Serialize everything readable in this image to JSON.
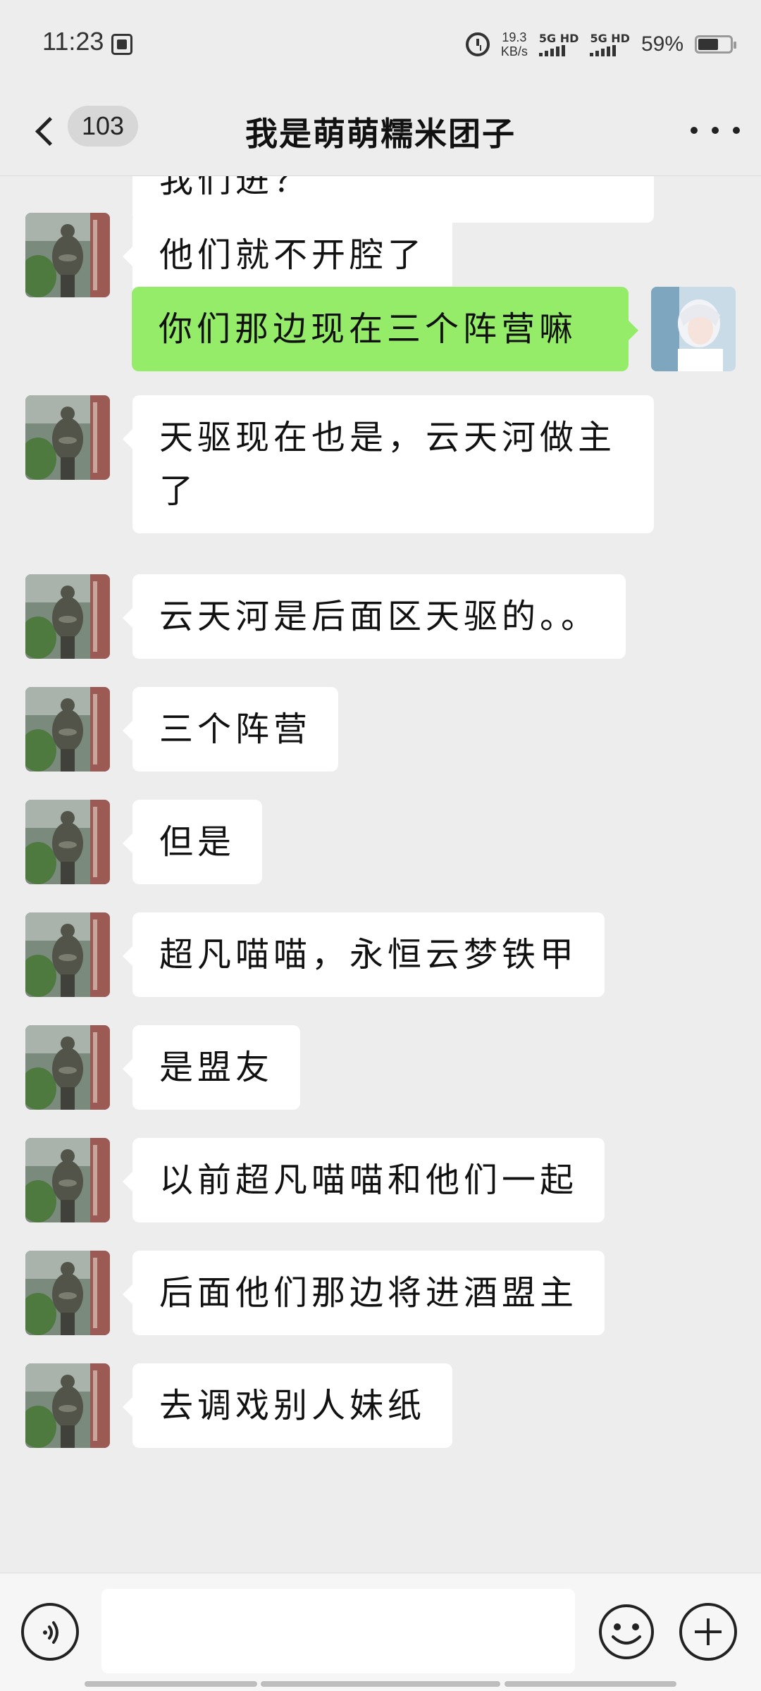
{
  "status_bar": {
    "time": "11:23",
    "net_speed_value": "19.3",
    "net_speed_unit": "KB/s",
    "sim1": "5G HD",
    "sim2": "5G HD",
    "battery": "59%",
    "battery_level": 0.59
  },
  "header": {
    "unread_count": "103",
    "title": "我是萌萌糯米团子"
  },
  "messages": [
    {
      "side": "in",
      "text": "自己和盟友闹掰。你们会让我们进？"
    },
    {
      "side": "in",
      "text": "他们就不开腔了"
    },
    {
      "side": "out",
      "text": "你们那边现在三个阵营嘛"
    },
    {
      "side": "in",
      "text": "天驱现在也是，云天河做主了"
    },
    {
      "side": "in",
      "text": "云天河是后面区天驱的。。"
    },
    {
      "side": "in",
      "text": "三个阵营"
    },
    {
      "side": "in",
      "text": "但是"
    },
    {
      "side": "in",
      "text": "超凡喵喵，永恒云梦铁甲"
    },
    {
      "side": "in",
      "text": "是盟友"
    },
    {
      "side": "in",
      "text": "以前超凡喵喵和他们一起"
    },
    {
      "side": "in",
      "text": "后面他们那边将进酒盟主"
    },
    {
      "side": "in",
      "text": "去调戏别人妹纸"
    }
  ],
  "colors": {
    "background": "#ededed",
    "incoming_bubble": "#ffffff",
    "outgoing_bubble": "#95ec69"
  },
  "icons": {
    "back": "chevron-left-icon",
    "more": "ellipsis-icon",
    "voice": "voice-icon",
    "emoji": "smiley-icon",
    "plus": "plus-icon"
  }
}
